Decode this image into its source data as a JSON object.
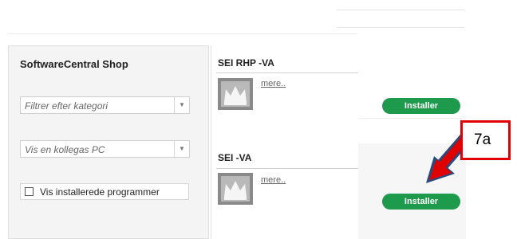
{
  "sidebar": {
    "title": "SoftwareCentral Shop",
    "category_filter_placeholder": "Filtrer efter kategori",
    "colleague_pc_placeholder": "Vis en kollegas PC",
    "show_installed_label": "Vis installerede programmer"
  },
  "products": [
    {
      "name": "SEI RHP -VA",
      "more_link": "mere..",
      "install_label": "Installer"
    },
    {
      "name": "SEI -VA",
      "more_link": "mere..",
      "install_label": "Installer"
    }
  ],
  "annotation": {
    "callout_label": "7a",
    "color": "#e00000"
  },
  "colors": {
    "install_button": "#1d9a4c",
    "arrow": "#e00000"
  },
  "icons": {
    "caret": "chevron-down-icon",
    "thumbnail": "app-thumbnail-icon"
  }
}
